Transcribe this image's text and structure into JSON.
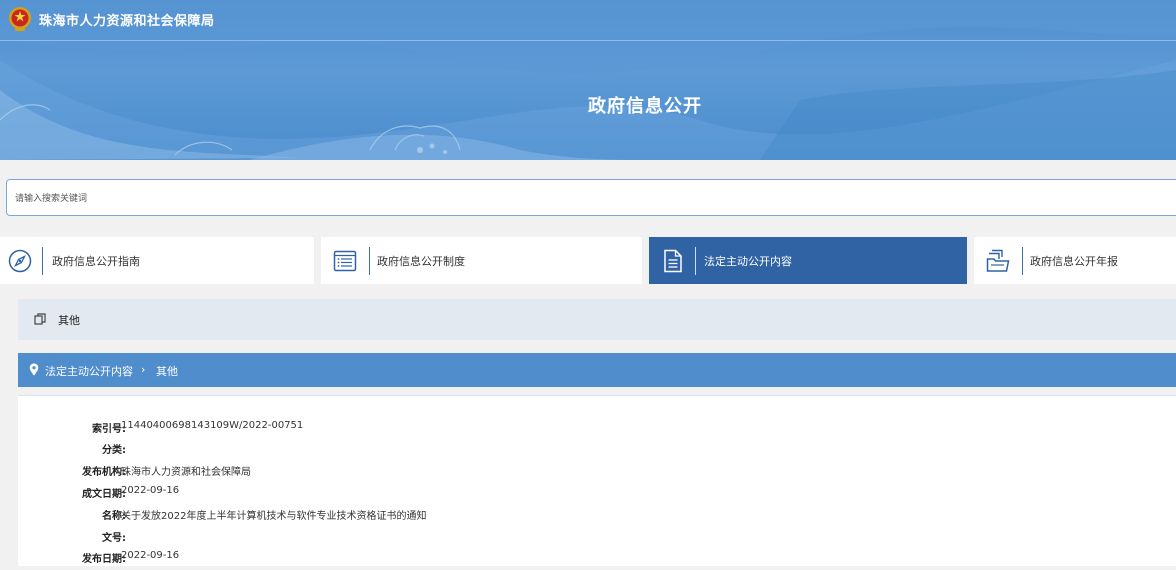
{
  "header": {
    "site_title": "珠海市人力资源和社会保障局",
    "page_title": "政府信息公开"
  },
  "search": {
    "placeholder": "请输入搜索关键词"
  },
  "tabs": [
    {
      "label": "政府信息公开指南",
      "icon": "compass-icon",
      "active": false
    },
    {
      "label": "政府信息公开制度",
      "icon": "list-icon",
      "active": false
    },
    {
      "label": "法定主动公开内容",
      "icon": "document-icon",
      "active": true
    },
    {
      "label": "政府信息公开年报",
      "icon": "folder-icon",
      "active": false
    }
  ],
  "category": {
    "label": "其他",
    "icon": "copy-icon"
  },
  "breadcrumb": {
    "items": [
      "法定主动公开内容",
      "其他"
    ],
    "separator": "›"
  },
  "detail": {
    "rows": [
      {
        "key": "索引号:",
        "value": "11440400698143109W/2022-00751"
      },
      {
        "key": "分类:",
        "value": ""
      },
      {
        "key": "发布机构:",
        "value": "珠海市人力资源和社会保障局"
      },
      {
        "key": "成文日期:",
        "value": "2022-09-16"
      },
      {
        "key": "名称:",
        "value": "关于发放2022年度上半年计算机技术与软件专业技术资格证书的通知"
      },
      {
        "key": "文号:",
        "value": ""
      },
      {
        "key": "发布日期:",
        "value": "2022-09-16"
      }
    ]
  },
  "colors": {
    "banner": "#4f8dcd",
    "active_tab": "#2f63a4",
    "breadcrumb_bar": "#4f8dcd",
    "category_bar": "#e2e9f1"
  }
}
